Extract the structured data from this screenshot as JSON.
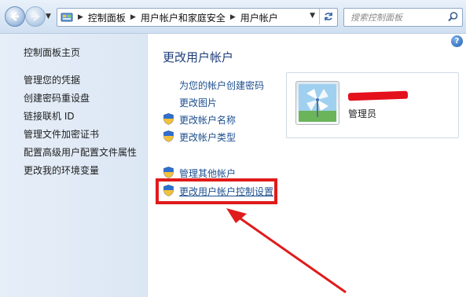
{
  "addressbar": {
    "breadcrumbs": [
      "控制面板",
      "用户帐户和家庭安全",
      "用户帐户"
    ],
    "search_placeholder": "搜索控制面板"
  },
  "sidebar": {
    "home": "控制面板主页",
    "items": [
      "管理您的凭据",
      "创建密码重设盘",
      "链接联机 ID",
      "管理文件加密证书",
      "配置高级用户配置文件属性",
      "更改我的环境变量"
    ]
  },
  "main": {
    "title": "更改用户帐户",
    "links": {
      "create_password": "为您的帐户创建密码",
      "change_picture": "更改图片",
      "change_name": "更改帐户名称",
      "change_type": "更改帐户类型",
      "manage_other": "管理其他帐户",
      "uac_settings": "更改用户帐户控制设置"
    }
  },
  "user_card": {
    "role": "管理员"
  },
  "icons": {
    "back": "back-arrow-icon",
    "forward": "forward-arrow-icon",
    "control_panel": "control-panel-icon",
    "refresh": "refresh-icon",
    "search": "search-icon",
    "help": "help-icon",
    "shield": "uac-shield-icon"
  },
  "colors": {
    "link": "#1c4f8f",
    "title": "#1f3d7a",
    "annotation_red": "#e01b1b",
    "sidebar_bg": "#e6eef8"
  }
}
